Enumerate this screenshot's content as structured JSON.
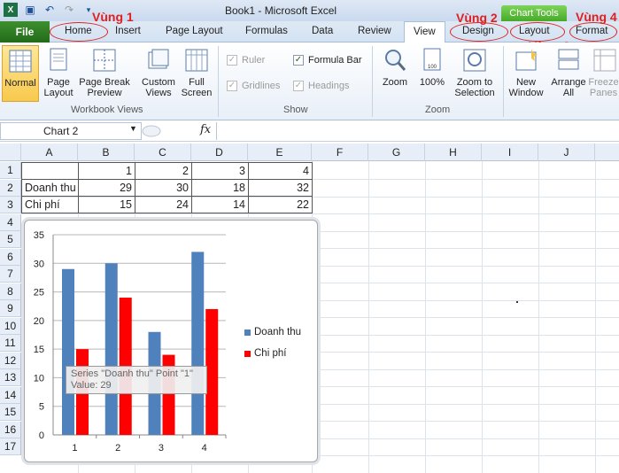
{
  "titlebar": {
    "title": "Book1  -  Microsoft Excel",
    "chart_tools": "Chart Tools"
  },
  "tabs": {
    "file": "File",
    "home": "Home",
    "insert": "Insert",
    "page_layout": "Page Layout",
    "formulas": "Formulas",
    "data": "Data",
    "review": "Review",
    "view": "View",
    "design": "Design",
    "layout": "Layout",
    "format": "Format"
  },
  "annotations": {
    "vung1": "Vùng 1",
    "vung2": "Vùng 2",
    "vung3": "Vùng 3",
    "vung4": "Vùng 4",
    "color": "#e02020"
  },
  "ribbon": {
    "workbook_views": {
      "label": "Workbook Views",
      "normal": "Normal",
      "page_layout": [
        "Page",
        "Layout"
      ],
      "page_break": [
        "Page Break",
        "Preview"
      ],
      "custom_views": [
        "Custom",
        "Views"
      ],
      "full_screen": [
        "Full",
        "Screen"
      ]
    },
    "show": {
      "label": "Show",
      "ruler": "Ruler",
      "formula_bar": "Formula Bar",
      "gridlines": "Gridlines",
      "headings": "Headings"
    },
    "zoom": {
      "label": "Zoom",
      "zoom": "Zoom",
      "hundred": "100%",
      "zoom_to_selection": [
        "Zoom to",
        "Selection"
      ]
    },
    "window": {
      "new_window": [
        "New",
        "Window"
      ],
      "arrange_all": [
        "Arrange",
        "All"
      ],
      "freeze_panes": [
        "Freeze",
        "Panes"
      ]
    }
  },
  "formula_bar": {
    "name_box": "Chart 2",
    "fx": "fx",
    "formula": ""
  },
  "grid": {
    "columns": [
      "A",
      "B",
      "C",
      "D",
      "E",
      "F",
      "G",
      "H",
      "I",
      "J"
    ],
    "rows": [
      "1",
      "2",
      "3",
      "4",
      "5",
      "6",
      "7",
      "8",
      "9",
      "10",
      "11",
      "12",
      "13",
      "14",
      "15",
      "16",
      "17"
    ],
    "row1": [
      "",
      "1",
      "2",
      "3",
      "4"
    ],
    "row2": [
      "Doanh thu",
      "29",
      "30",
      "18",
      "32"
    ],
    "row3": [
      "Chi phí",
      "15",
      "24",
      "14",
      "22"
    ]
  },
  "chart_data": {
    "type": "bar",
    "categories": [
      "1",
      "2",
      "3",
      "4"
    ],
    "series": [
      {
        "name": "Doanh thu",
        "values": [
          29,
          30,
          18,
          32
        ],
        "color": "#4f81bd"
      },
      {
        "name": "Chi phí",
        "values": [
          15,
          24,
          14,
          22
        ],
        "color": "#ff0000"
      }
    ],
    "ylim": [
      0,
      35
    ],
    "yticks": [
      "0",
      "5",
      "10",
      "15",
      "20",
      "25",
      "30",
      "35"
    ],
    "grid": true,
    "legend": "right"
  },
  "tooltip": {
    "line1": "Series \"Doanh thu\" Point \"1\"",
    "line2": "Value: 29"
  }
}
